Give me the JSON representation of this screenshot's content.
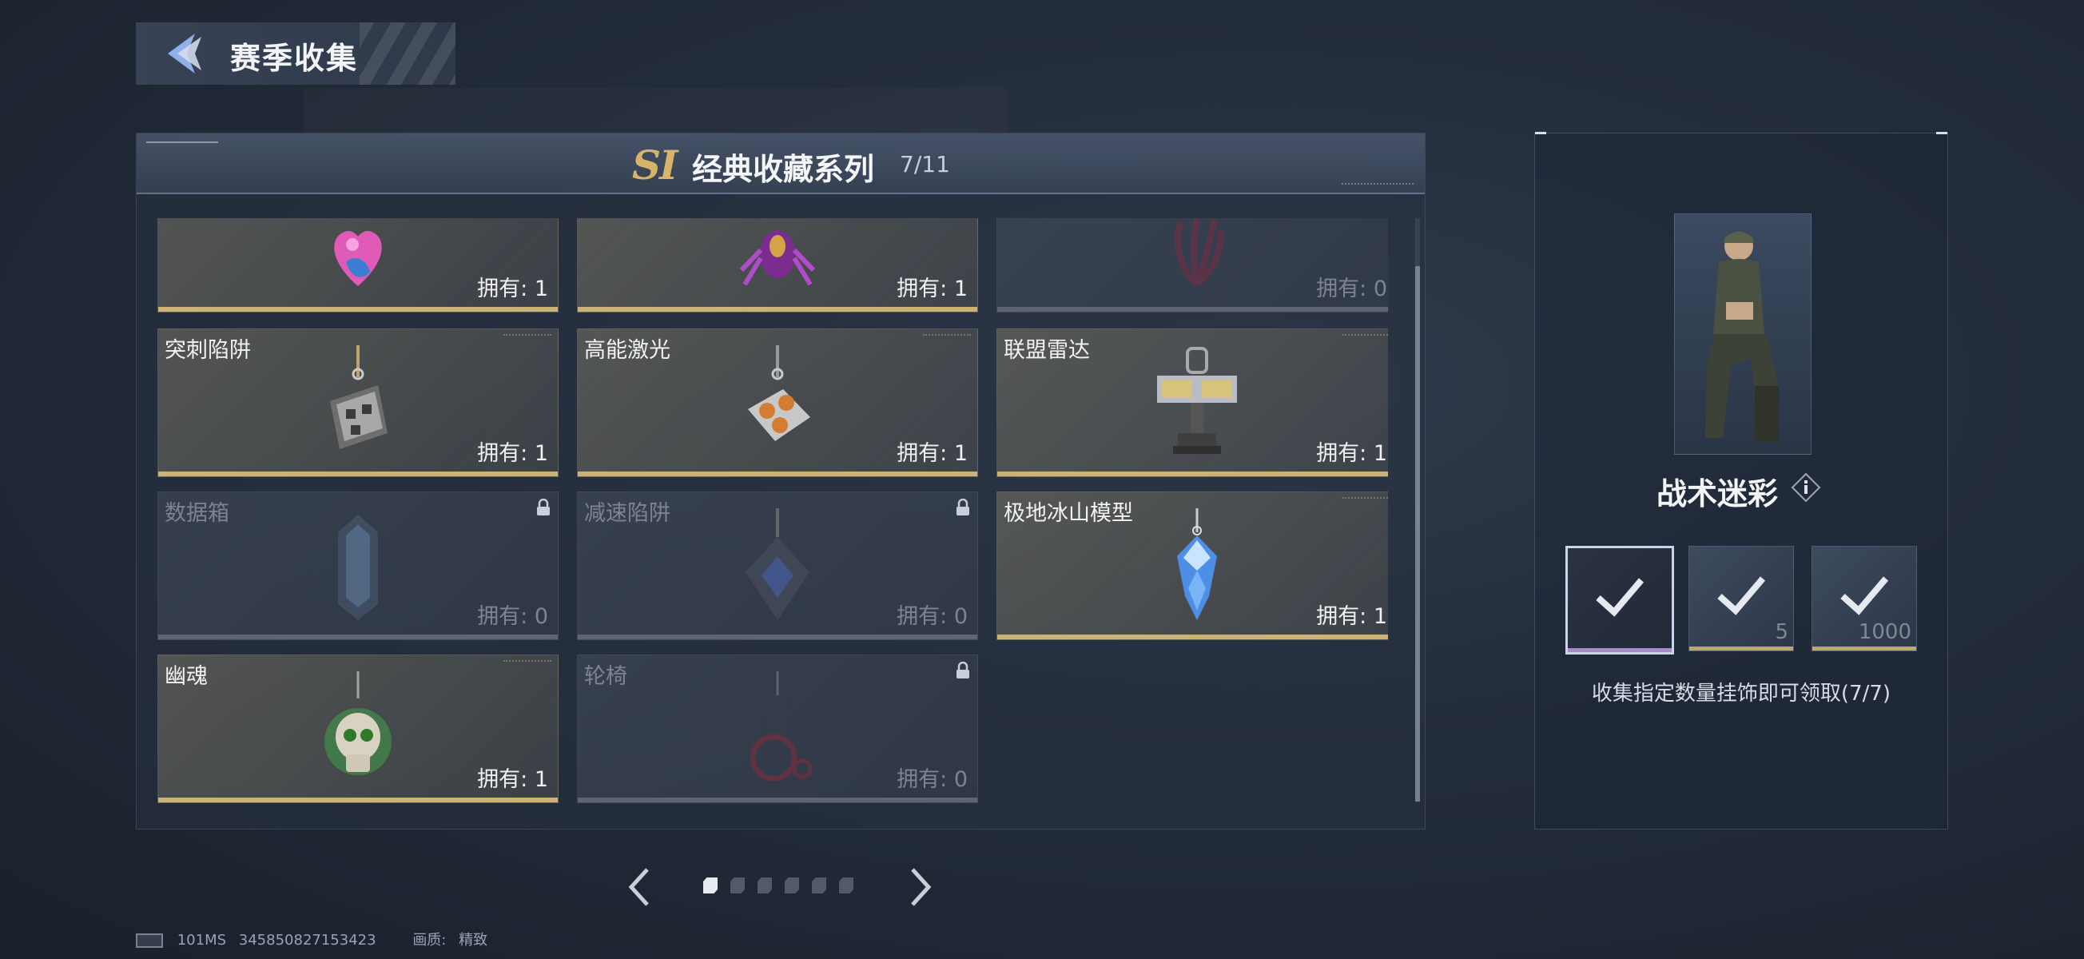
{
  "header": {
    "title": "赛季收集"
  },
  "series": {
    "badge": "SI",
    "title": "经典收藏系列",
    "count": "7/11"
  },
  "cards": [
    {
      "name": "",
      "own": "拥有: 1",
      "locked": false,
      "icon": "pink-heart-charm-icon"
    },
    {
      "name": "",
      "own": "拥有: 1",
      "locked": false,
      "icon": "purple-spider-charm-icon"
    },
    {
      "name": "",
      "own": "拥有: 0",
      "locked": true,
      "icon": "red-tentacle-charm-icon"
    },
    {
      "name": "突刺陷阱",
      "own": "拥有: 1",
      "locked": false,
      "icon": "spike-trap-charm-icon"
    },
    {
      "name": "高能激光",
      "own": "拥有: 1",
      "locked": false,
      "icon": "laser-charm-icon"
    },
    {
      "name": "联盟雷达",
      "own": "拥有: 1",
      "locked": false,
      "icon": "radar-charm-icon"
    },
    {
      "name": "数据箱",
      "own": "拥有: 0",
      "locked": true,
      "icon": "data-box-charm-icon"
    },
    {
      "name": "减速陷阱",
      "own": "拥有: 0",
      "locked": true,
      "icon": "slow-trap-charm-icon"
    },
    {
      "name": "极地冰山模型",
      "own": "拥有: 1",
      "locked": false,
      "icon": "iceberg-charm-icon"
    },
    {
      "name": "幽魂",
      "own": "拥有: 1",
      "locked": false,
      "icon": "ghost-skull-charm-icon"
    },
    {
      "name": "轮椅",
      "own": "拥有: 0",
      "locked": true,
      "icon": "wheelchair-charm-icon"
    }
  ],
  "reward": {
    "name": "战术迷彩",
    "tiers": [
      {
        "num": "",
        "selected": true
      },
      {
        "num": "5",
        "selected": false
      },
      {
        "num": "1000",
        "selected": false
      }
    ],
    "desc": "收集指定数量挂饰即可领取(7/7)"
  },
  "pager": {
    "total": 6,
    "active": 0
  },
  "footer": {
    "ping": "101MS",
    "id": "345850827153423",
    "quality_label": "画质:",
    "quality_value": "精致"
  },
  "colors": {
    "accent_gold": "#cdb277",
    "locked_gray": "#7c8494",
    "selected_purple": "#a78bc9"
  }
}
